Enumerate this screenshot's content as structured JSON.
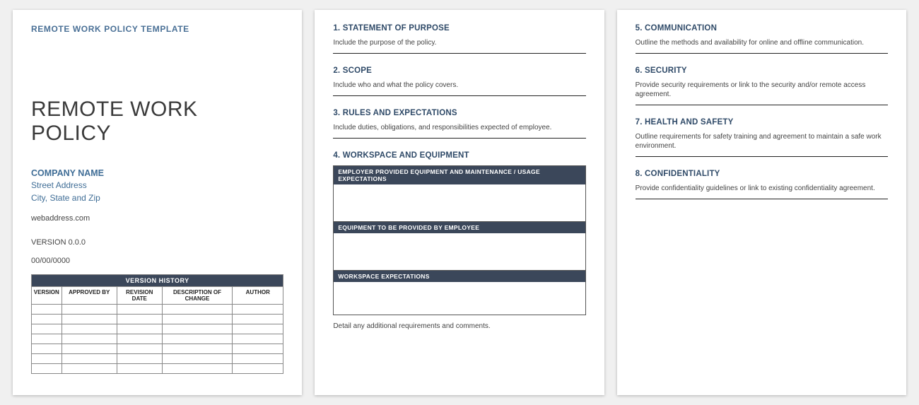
{
  "page1": {
    "template_label": "REMOTE WORK POLICY TEMPLATE",
    "title": "REMOTE WORK POLICY",
    "company_name": "COMPANY NAME",
    "street": "Street Address",
    "city_state_zip": "City, State and Zip",
    "web": "webaddress.com",
    "version_line": "VERSION 0.0.0",
    "date_line": "00/00/0000",
    "version_history": {
      "title": "VERSION HISTORY",
      "columns": [
        "VERSION",
        "APPROVED BY",
        "REVISION DATE",
        "DESCRIPTION OF CHANGE",
        "AUTHOR"
      ]
    }
  },
  "page2": {
    "s1": {
      "head": "1.  STATEMENT OF PURPOSE",
      "body": "Include the purpose of the policy."
    },
    "s2": {
      "head": "2.  SCOPE",
      "body": "Include who and what the policy covers."
    },
    "s3": {
      "head": "3.  RULES AND EXPECTATIONS",
      "body": "Include duties, obligations, and responsibilities expected of employee."
    },
    "s4": {
      "head": "4.  WORKSPACE AND EQUIPMENT",
      "bar1": "EMPLOYER PROVIDED EQUIPMENT AND MAINTENANCE / USAGE EXPECTATIONS",
      "bar2": "EQUIPMENT TO BE PROVIDED BY EMPLOYEE",
      "bar3": "WORKSPACE EXPECTATIONS",
      "detail": "Detail any additional requirements and comments."
    }
  },
  "page3": {
    "s5": {
      "head": "5.  COMMUNICATION",
      "body": "Outline the methods and availability for online and offline communication."
    },
    "s6": {
      "head": "6.  SECURITY",
      "body": "Provide security requirements or link to the security and/or remote access agreement."
    },
    "s7": {
      "head": "7.  HEALTH AND SAFETY",
      "body": "Outline requirements for safety training and agreement to maintain a safe work environment."
    },
    "s8": {
      "head": "8.  CONFIDENTIALITY",
      "body": "Provide confidentiality guidelines or link to existing confidentiality agreement."
    }
  }
}
